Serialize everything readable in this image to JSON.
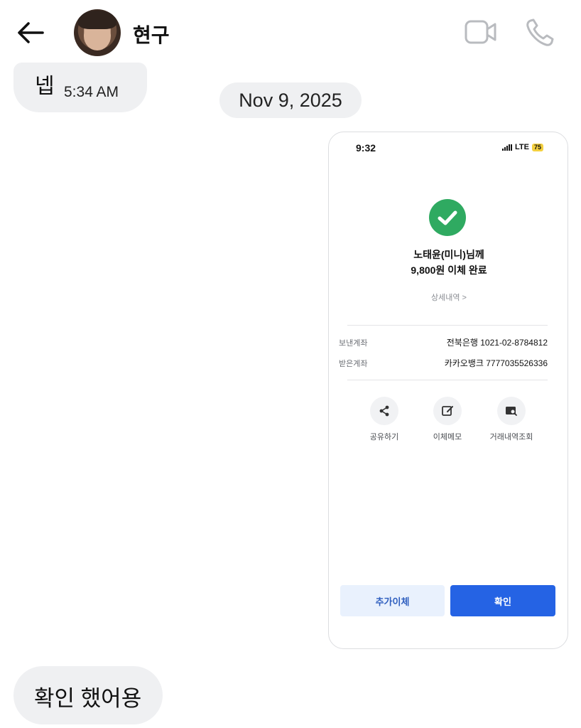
{
  "header": {
    "contact_name": "현구"
  },
  "messages": {
    "top_text": "넵",
    "top_time": "5:34 AM",
    "date_separator": "Nov 9, 2025",
    "bottom_text": "확인 했어용"
  },
  "screenshot": {
    "status_time": "9:32",
    "status_network": "LTE",
    "status_battery": "75",
    "recipient_line": "노태윤(미니)님께",
    "amount_line": "9,800원 이체 완료",
    "detail_link": "상세내역 >",
    "sent_label": "보낸계좌",
    "sent_value": "전북은행 1021-02-8784812",
    "recv_label": "받은계좌",
    "recv_value": "카카오뱅크 7777035526336",
    "actions": [
      {
        "label": "공유하기",
        "icon": "share-icon"
      },
      {
        "label": "이체메모",
        "icon": "memo-edit-icon"
      },
      {
        "label": "거래내역조회",
        "icon": "transaction-search-icon"
      }
    ],
    "btn_more": "추가이체",
    "btn_confirm": "확인"
  },
  "colors": {
    "bubble_bg": "#eff0f2",
    "success_green": "#2faa61",
    "primary_blue": "#2563e4",
    "secondary_blue_bg": "#e9f1fd"
  }
}
